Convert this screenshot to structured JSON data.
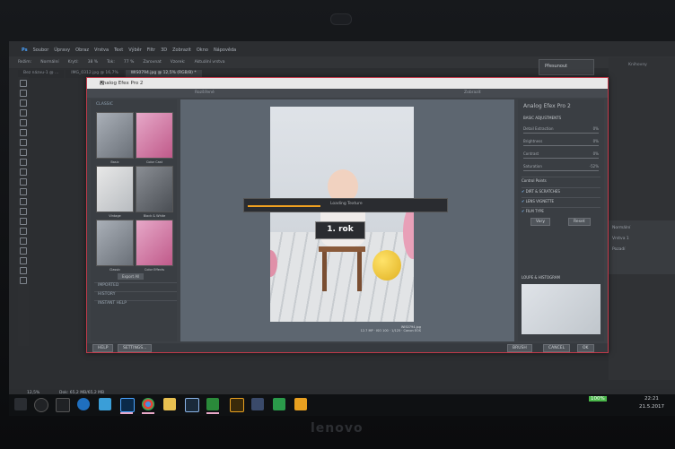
{
  "colors": {
    "accent": "#c23a4a",
    "loading_bar": "#f0a020",
    "ps_blue": "#4aa3ff"
  },
  "menubar": {
    "logo": "Ps",
    "items": [
      "Soubor",
      "Úpravy",
      "Obraz",
      "Vrstva",
      "Text",
      "Výběr",
      "Filtr",
      "3D",
      "Zobrazit",
      "Okno",
      "Nápověda"
    ]
  },
  "optionsbar": {
    "items": [
      "Režim:",
      "Normální",
      "Krytí:",
      "38 %",
      "Tok:",
      "77 %",
      "Zarovnat",
      "Vzorek:",
      "Aktuální vrstva"
    ]
  },
  "tabs": [
    "Bez názvu-1 @ ...",
    "IMG_0312.jpg @ 16,7%",
    "WIS0794.jpg @ 12,5% (RGB/8) *"
  ],
  "smallwin": {
    "label": "Přesunout"
  },
  "rightpanel": {
    "label": "Knihovny"
  },
  "layerpanel": {
    "rows": [
      "Normální",
      "Vrstva 1",
      "Pozadí"
    ]
  },
  "dialog": {
    "title": "Analog Efex Pro 2",
    "title_controls": [
      "–",
      "□",
      "✕"
    ],
    "topbar": [
      "Rozšířené",
      "Zobrazit"
    ],
    "left": {
      "heading": "CLASSIC",
      "thumbs": [
        {
          "caption": "Basic",
          "style": "gray"
        },
        {
          "caption": "Color Cast",
          "style": "pink"
        },
        {
          "caption": "Vintage",
          "style": "pale"
        },
        {
          "caption": "Black & White",
          "style": "dark"
        },
        {
          "caption": "Classic",
          "style": "gray"
        },
        {
          "caption": "Color Effects",
          "style": "pink"
        }
      ],
      "export_label": "Export All",
      "sections": [
        "IMPORTED",
        "HISTORY",
        "INSTANT HELP"
      ]
    },
    "photo": {
      "sign_text": "1. rok",
      "caption_line1": "WIS0794.jpg",
      "caption_line2": "12.7 MP · ISO 100 · 1/125 · Canon EOS"
    },
    "loading": {
      "text": "Loading Texture",
      "progress": 0.37
    },
    "right": {
      "title": "Analog Efex Pro 2",
      "section_basic": "BASIC ADJUSTMENTS",
      "rows": [
        {
          "label": "Detail Extraction",
          "value": "0%"
        },
        {
          "label": "Brightness",
          "value": "0%"
        },
        {
          "label": "Contrast",
          "value": "0%"
        },
        {
          "label": "Saturation",
          "value": "-52%"
        }
      ],
      "section_control": "Control Points",
      "checked_sections": [
        "DIRT & SCRATCHES",
        "LENS VIGNETTE",
        "FILM TYPE"
      ],
      "small_buttons": [
        "Vary",
        "Reset"
      ],
      "loupe_title": "LOUPE & HISTOGRAM"
    },
    "bottom": {
      "help": "HELP",
      "settings": "SETTINGS...",
      "brush": "BRUSH",
      "cancel": "CANCEL",
      "ok": "OK"
    }
  },
  "statusbar": {
    "zoom": "12,5%",
    "doc": "Dok: 65,2 MB/65,2 MB"
  },
  "taskbar": {
    "time": "22:21",
    "date": "21.5.2017",
    "battery": "100%"
  },
  "brand": "lenovo"
}
